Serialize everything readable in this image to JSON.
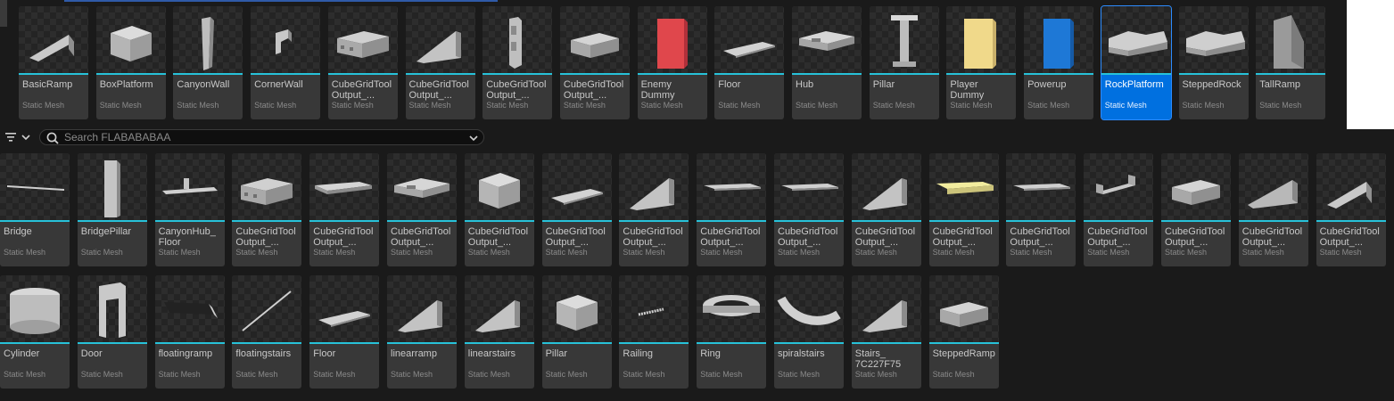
{
  "colors": {
    "background": "#1a1a1a",
    "tile": "#383838",
    "accent": "#27c2d9",
    "selected": "#0070e0"
  },
  "search": {
    "placeholder": "Search FLABABABAA",
    "value": ""
  },
  "icons": {
    "filter": "filter-icon",
    "dropdown": "chevron-down-icon",
    "search": "search-icon",
    "search_options": "chevron-down-icon"
  },
  "top_row": [
    {
      "name": "BasicRamp",
      "type": "Static Mesh",
      "shape": "ramp"
    },
    {
      "name": "BoxPlatform",
      "type": "Static Mesh",
      "shape": "box"
    },
    {
      "name": "CanyonWall",
      "type": "Static Mesh",
      "shape": "wall"
    },
    {
      "name": "CornerWall",
      "type": "Static Mesh",
      "shape": "corner"
    },
    {
      "name": "CubeGridTool Output_...",
      "type": "Static Mesh",
      "shape": "building"
    },
    {
      "name": "CubeGridTool Output_...",
      "type": "Static Mesh",
      "shape": "wedge"
    },
    {
      "name": "CubeGridTool Output_...",
      "type": "Static Mesh",
      "shape": "tower"
    },
    {
      "name": "CubeGridTool Output_...",
      "type": "Static Mesh",
      "shape": "block"
    },
    {
      "name": "Enemy Dummy",
      "type": "Static Mesh",
      "shape": "red"
    },
    {
      "name": "Floor",
      "type": "Static Mesh",
      "shape": "floor"
    },
    {
      "name": "Hub",
      "type": "Static Mesh",
      "shape": "hub"
    },
    {
      "name": "Pillar",
      "type": "Static Mesh",
      "shape": "pillar"
    },
    {
      "name": "Player Dummy",
      "type": "Static Mesh",
      "shape": "yellow"
    },
    {
      "name": "Powerup",
      "type": "Static Mesh",
      "shape": "blue"
    },
    {
      "name": "RockPlatform",
      "type": "Static Mesh",
      "shape": "rock",
      "selected": true
    },
    {
      "name": "SteppedRock",
      "type": "Static Mesh",
      "shape": "rock"
    },
    {
      "name": "TallRamp",
      "type": "Static Mesh",
      "shape": "tallramp"
    }
  ],
  "middle_row": [
    {
      "name": "Bridge",
      "type": "Static Mesh",
      "shape": "bridge"
    },
    {
      "name": "BridgePillar",
      "type": "Static Mesh",
      "shape": "bpillar"
    },
    {
      "name": "CanyonHub_ Floor",
      "type": "Static Mesh",
      "shape": "canyonhub"
    },
    {
      "name": "CubeGridTool Output_...",
      "type": "Static Mesh",
      "shape": "building"
    },
    {
      "name": "CubeGridTool Output_...",
      "type": "Static Mesh",
      "shape": "slab"
    },
    {
      "name": "CubeGridTool Output_...",
      "type": "Static Mesh",
      "shape": "hub"
    },
    {
      "name": "CubeGridTool Output_...",
      "type": "Static Mesh",
      "shape": "box"
    },
    {
      "name": "CubeGridTool Output_...",
      "type": "Static Mesh",
      "shape": "floor"
    },
    {
      "name": "CubeGridTool Output_...",
      "type": "Static Mesh",
      "shape": "wedge"
    },
    {
      "name": "CubeGridTool Output_...",
      "type": "Static Mesh",
      "shape": "thinslab"
    },
    {
      "name": "CubeGridTool Output_...",
      "type": "Static Mesh",
      "shape": "thinslab"
    },
    {
      "name": "CubeGridTool Output_...",
      "type": "Static Mesh",
      "shape": "wedge"
    },
    {
      "name": "CubeGridTool Output_...",
      "type": "Static Mesh",
      "shape": "yellowslab"
    },
    {
      "name": "CubeGridTool Output_...",
      "type": "Static Mesh",
      "shape": "thinslab"
    },
    {
      "name": "CubeGridTool Output_...",
      "type": "Static Mesh",
      "shape": "channel"
    },
    {
      "name": "CubeGridTool Output_...",
      "type": "Static Mesh",
      "shape": "block"
    },
    {
      "name": "CubeGridTool Output_...",
      "type": "Static Mesh",
      "shape": "stairs"
    },
    {
      "name": "CubeGridTool Output_...",
      "type": "Static Mesh",
      "shape": "ramp"
    }
  ],
  "bottom_row": [
    {
      "name": "Cylinder",
      "type": "Static Mesh",
      "shape": "cylinder"
    },
    {
      "name": "Door",
      "type": "Static Mesh",
      "shape": "door"
    },
    {
      "name": "floatingramp",
      "type": "Static Mesh",
      "shape": "plank"
    },
    {
      "name": "floatingstairs",
      "type": "Static Mesh",
      "shape": "diag"
    },
    {
      "name": "Floor",
      "type": "Static Mesh",
      "shape": "floor"
    },
    {
      "name": "linearramp",
      "type": "Static Mesh",
      "shape": "wedge"
    },
    {
      "name": "linearstairs",
      "type": "Static Mesh",
      "shape": "wedge"
    },
    {
      "name": "Pillar",
      "type": "Static Mesh",
      "shape": "box"
    },
    {
      "name": "Railing",
      "type": "Static Mesh",
      "shape": "railing"
    },
    {
      "name": "Ring",
      "type": "Static Mesh",
      "shape": "ring"
    },
    {
      "name": "spiralstairs",
      "type": "Static Mesh",
      "shape": "spiral"
    },
    {
      "name": "Stairs_ 7C227F75",
      "type": "Static Mesh",
      "shape": "wedge"
    },
    {
      "name": "SteppedRamp",
      "type": "Static Mesh",
      "shape": "block"
    }
  ]
}
